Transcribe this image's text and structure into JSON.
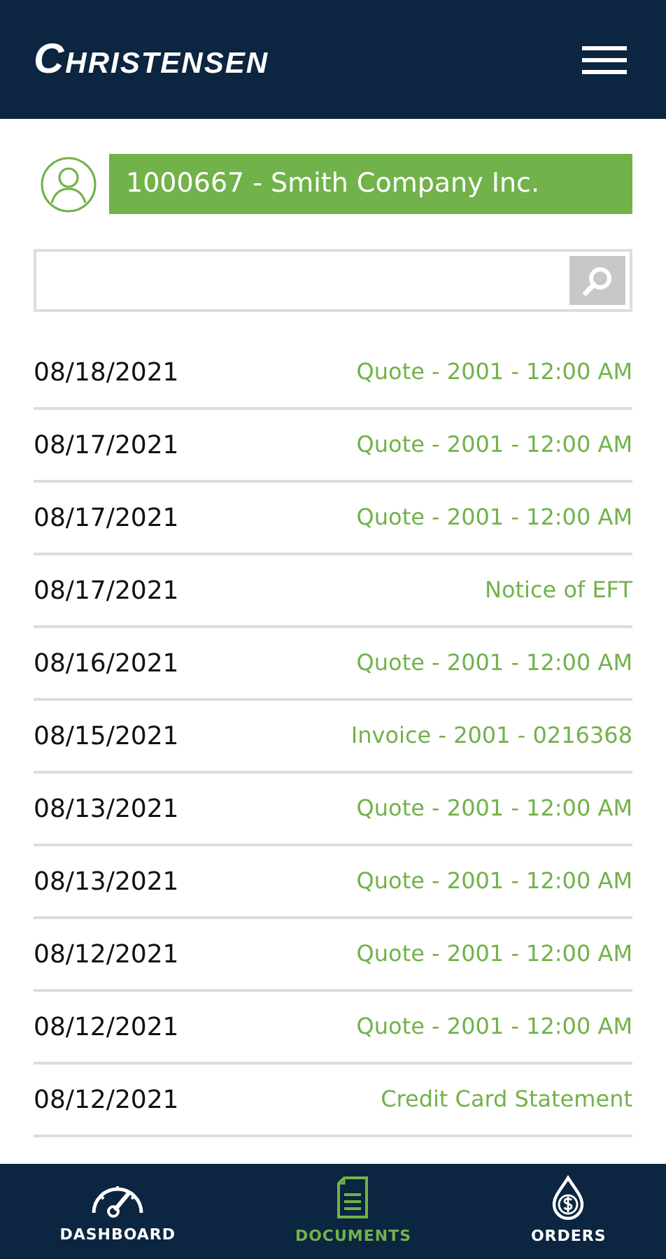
{
  "header": {
    "logo": "Christensen"
  },
  "customer": {
    "label": "1000667 - Smith Company Inc."
  },
  "documents": [
    {
      "date": "08/18/2021",
      "title": "Quote - 2001 - 12:00 AM"
    },
    {
      "date": "08/17/2021",
      "title": "Quote - 2001 - 12:00 AM"
    },
    {
      "date": "08/17/2021",
      "title": "Quote - 2001 - 12:00 AM"
    },
    {
      "date": "08/17/2021",
      "title": "Notice of EFT"
    },
    {
      "date": "08/16/2021",
      "title": "Quote - 2001 - 12:00 AM"
    },
    {
      "date": "08/15/2021",
      "title": "Invoice - 2001 - 0216368"
    },
    {
      "date": "08/13/2021",
      "title": "Quote - 2001 - 12:00 AM"
    },
    {
      "date": "08/13/2021",
      "title": "Quote - 2001 - 12:00 AM"
    },
    {
      "date": "08/12/2021",
      "title": "Quote - 2001 - 12:00 AM"
    },
    {
      "date": "08/12/2021",
      "title": "Quote - 2001 - 12:00 AM"
    },
    {
      "date": "08/12/2021",
      "title": "Credit Card Statement"
    }
  ],
  "tabs": [
    {
      "kind": "dashboard",
      "label": "DASHBOARD",
      "selected": false
    },
    {
      "kind": "documents",
      "label": "DOCUMENTS",
      "selected": true
    },
    {
      "kind": "orders",
      "label": "ORDERS",
      "selected": false
    }
  ]
}
